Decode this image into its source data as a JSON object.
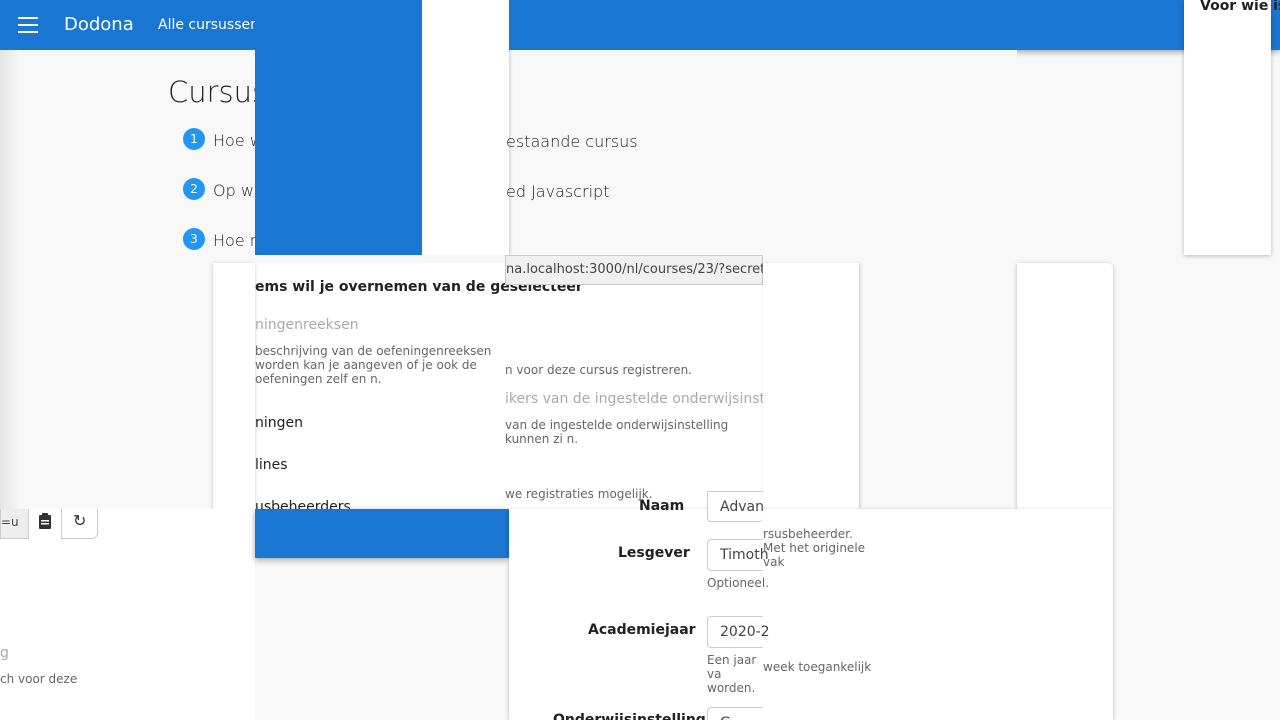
{
  "app": {
    "brand": "Dodona",
    "nav_all_courses": "Alle cursussen"
  },
  "page": {
    "title": "Cursus",
    "steps": [
      {
        "num": "1",
        "label": "Hoe w"
      },
      {
        "num": "2",
        "label": "Op we"
      },
      {
        "num": "3",
        "label": "Hoe m"
      }
    ],
    "step_right": [
      "estaande cursus",
      "ed Javascript"
    ]
  },
  "side": {
    "heading": "Voor wie is"
  },
  "url_field": {
    "value": "na.localhost:3000/nl/courses/23/?secret="
  },
  "copy": {
    "title": "ems wil je overnemen van de geselecteer",
    "series": "ningenreeksen",
    "series_help": "beschrijving van de oefeningenreeksen worden kan je aangeven of je ook de oefeningen zelf en n.",
    "ex": "ningen",
    "deadlines": "lines",
    "managers": "usbeheerders"
  },
  "registration": {
    "help1": "n voor deze cursus registreren.",
    "inst_label": "ikers van de ingestelde onderwijsinstellin",
    "inst_help": "van de ingestelde onderwijsinstelling kunnen zi n.",
    "new_help": "we registraties mogelijk."
  },
  "form": {
    "name_label": "Naam",
    "name_value": "Advan",
    "teacher_label": "Lesgever",
    "teacher_value": "Timoth",
    "teacher_help": "Optioneel.",
    "year_label": "Academiejaar",
    "year_value": "2020-2",
    "year_help": "Een jaar va worden.",
    "year_help_right": "week toegankelijk",
    "inst_label": "Onderwijsinstelling",
    "inst_value": "G"
  },
  "manager_help": "rsusbeheerder. Met het originele vak",
  "left_frag": {
    "url": "=u",
    "muted": "g",
    "help": "ch voor deze"
  },
  "icons": {
    "copy": "clipboard-icon",
    "refresh": "refresh-icon",
    "menu": "menu-icon"
  },
  "colors": {
    "primary": "#1976d2",
    "step": "#2196f3"
  }
}
